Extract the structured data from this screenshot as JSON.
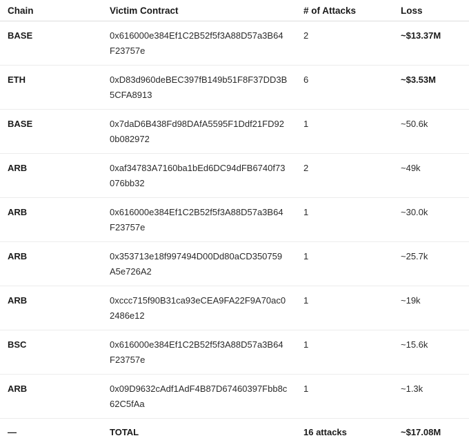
{
  "table": {
    "headers": {
      "chain": "Chain",
      "contract": "Victim Contract",
      "attacks": "# of Attacks",
      "loss": "Loss"
    },
    "rows": [
      {
        "chain": "BASE",
        "contract": "0x616000e384Ef1C2B52f5f3A88D57a3B64F23757e",
        "attacks": "2",
        "loss": "~$13.37M"
      },
      {
        "chain": "ETH",
        "contract": "0xD83d960deBEC397fB149b51F8F37DD3B5CFA8913",
        "attacks": "6",
        "loss": "~$3.53M"
      },
      {
        "chain": "BASE",
        "contract": "0x7daD6B438Fd98DAfA5595F1Ddf21FD920b082972",
        "attacks": "1",
        "loss": "~50.6k"
      },
      {
        "chain": "ARB",
        "contract": "0xaf34783A7160ba1bEd6DC94dFB6740f73076bb32",
        "attacks": "2",
        "loss": "~49k"
      },
      {
        "chain": "ARB",
        "contract": "0x616000e384Ef1C2B52f5f3A88D57a3B64F23757e",
        "attacks": "1",
        "loss": "~30.0k"
      },
      {
        "chain": "ARB",
        "contract": "0x353713e18f997494D00Dd80aCD350759A5e726A2",
        "attacks": "1",
        "loss": "~25.7k"
      },
      {
        "chain": "ARB",
        "contract": "0xccc715f90B31ca93eCEA9FA22F9A70ac02486e12",
        "attacks": "1",
        "loss": "~19k"
      },
      {
        "chain": "BSC",
        "contract": "0x616000e384Ef1C2B52f5f3A88D57a3B64F23757e",
        "attacks": "1",
        "loss": "~15.6k"
      },
      {
        "chain": "ARB",
        "contract": "0x09D9632cAdf1AdF4B87D67460397Fbb8c62C5fAa",
        "attacks": "1",
        "loss": "~1.3k"
      }
    ],
    "total": {
      "chain": "—",
      "contract": "TOTAL",
      "attacks": "16 attacks",
      "loss": "~$17.08M"
    }
  }
}
